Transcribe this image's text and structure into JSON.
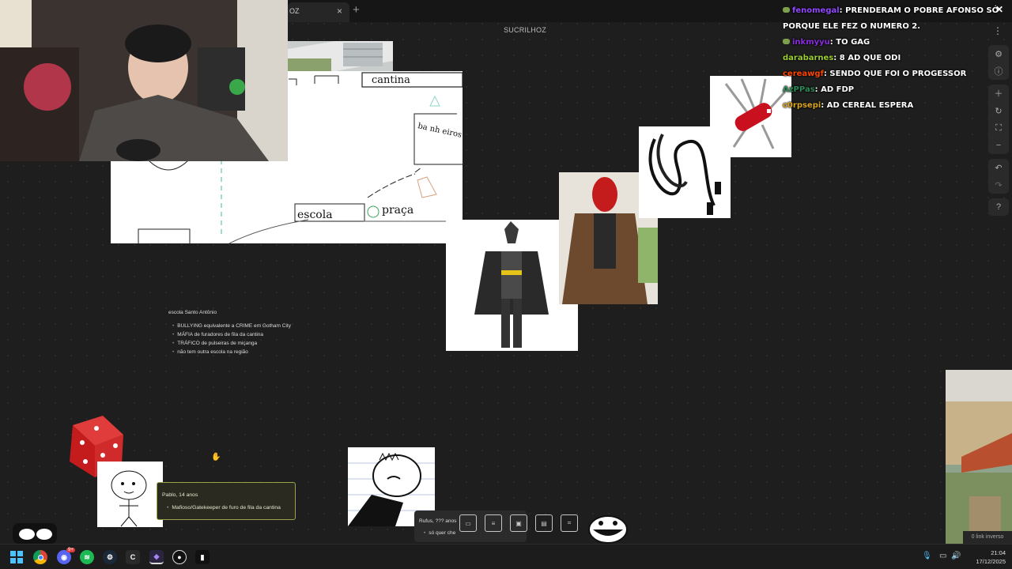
{
  "tab": {
    "label": "OZ",
    "close": "×",
    "add": "+"
  },
  "canvas_title": "SUCRILHOZ",
  "menu_dots": "⋮",
  "chat": [
    {
      "user": "fenomegal",
      "color": "#9147ff",
      "badge": true,
      "message": "PRENDERAM O POBRE AFONSO SÓ PORQUE ELE FEZ O NUMERO 2."
    },
    {
      "user": "inkmyyu",
      "color": "#8a2be2",
      "badge": true,
      "message": "TO GAG"
    },
    {
      "user": "darabarnes",
      "color": "#9acd32",
      "badge": false,
      "message": "8 AD QUE ODI"
    },
    {
      "user": "cereawgf",
      "color": "#ff4500",
      "badge": false,
      "message": "SENDO QUE FOI O PROGESSOR"
    },
    {
      "user": "AzPPas",
      "color": "#2e8b57",
      "badge": false,
      "message": "AD FDP"
    },
    {
      "user": "c0rpsepi",
      "color": "#daa520",
      "badge": false,
      "message": "AD CEREAL ESPERA"
    }
  ],
  "chat_close": "✕",
  "map_labels": {
    "cantina": "cantina",
    "banheiros": "ba nh eiros",
    "escola": "escola",
    "praca": "praça"
  },
  "school_note": {
    "title": "escola Santo Antônio",
    "items": [
      "BULLYING equivalente a CRIME em Gotham City",
      "MÁFIA de furadores de fila da cantina",
      "TRÁFICO de pulseiras de miçanga",
      "não tem outra escola na região"
    ]
  },
  "pablo_note": {
    "title": "Pablo, 14 anos",
    "item": "Mafioso/Gatekeeper de furo de fila da cantina"
  },
  "rufus_note": {
    "title": "Rufus, ??? anos",
    "item": "só quer che"
  },
  "link_box": "0 link inverso",
  "clock": {
    "time": "21:04",
    "date": "17/12/2025"
  },
  "discord_badge": "9+",
  "icons": [
    "gear-icon",
    "info-icon",
    "plus-icon",
    "rotate-icon",
    "fullscreen-icon",
    "minus-icon",
    "undo-icon",
    "redo-icon",
    "help-icon"
  ]
}
